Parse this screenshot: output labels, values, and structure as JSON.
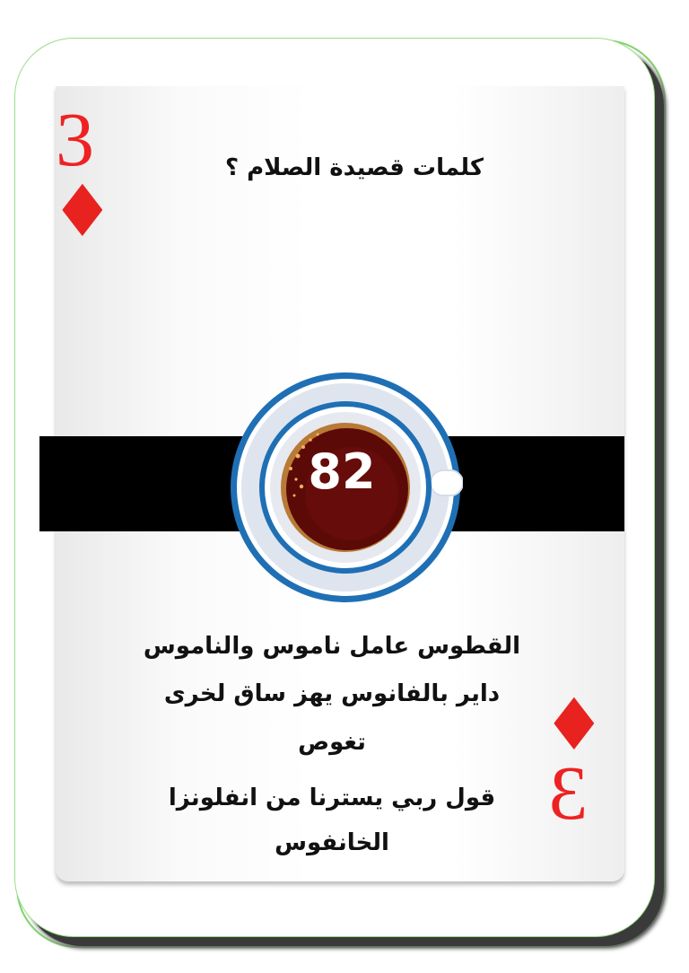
{
  "card": {
    "rank": "3",
    "suit_symbol": "♦",
    "suit_name": "diamond-icon",
    "suit_color": "#e8221e",
    "panel_accent": "#000000"
  },
  "question": "كلمات قصيدة الصلام ؟",
  "score": "82",
  "answer_lines": [
    "القطوس عامل ناموس والناموس",
    "داير بالفانوس يهز ساق لخرى",
    "تغوص",
    "قول ربي يسترنا من انفلونزا",
    "الخانفوس"
  ]
}
